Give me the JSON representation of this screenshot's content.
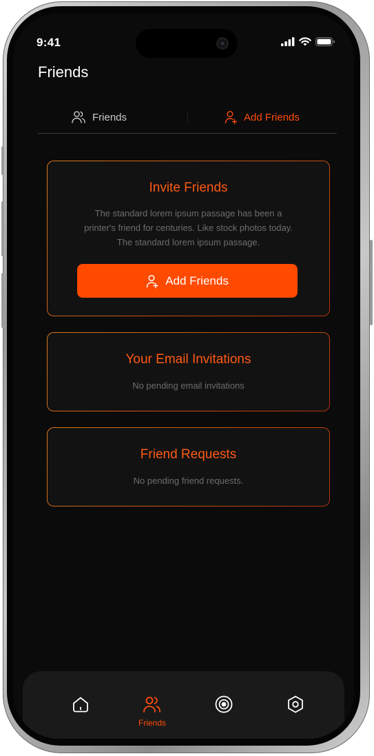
{
  "status": {
    "time": "9:41"
  },
  "header": {
    "title": "Friends"
  },
  "tabs": [
    {
      "label": "Friends",
      "icon": "users-icon",
      "active": false
    },
    {
      "label": "Add Friends",
      "icon": "user-add-icon",
      "active": true
    }
  ],
  "invite_card": {
    "title": "Invite Friends",
    "body_line1": "The standard lorem ipsum passage has been a",
    "body_line2": "printer's friend for centuries. Like stock photos today.",
    "body_line3": "The standard lorem ipsum passage.",
    "button_label": "Add Friends"
  },
  "email_card": {
    "title": "Your Email Invitations",
    "body": "No pending email invitations"
  },
  "requests_card": {
    "title": "Friend Requests",
    "body": "No pending friend requests."
  },
  "bottom_nav": {
    "items": [
      {
        "icon": "home-icon",
        "label": ""
      },
      {
        "icon": "friends-icon",
        "label": "Friends",
        "active": true
      },
      {
        "icon": "target-icon",
        "label": ""
      },
      {
        "icon": "settings-icon",
        "label": ""
      }
    ]
  },
  "colors": {
    "accent": "#ff4a00",
    "background": "#0b0b0b",
    "card": "#121212"
  }
}
